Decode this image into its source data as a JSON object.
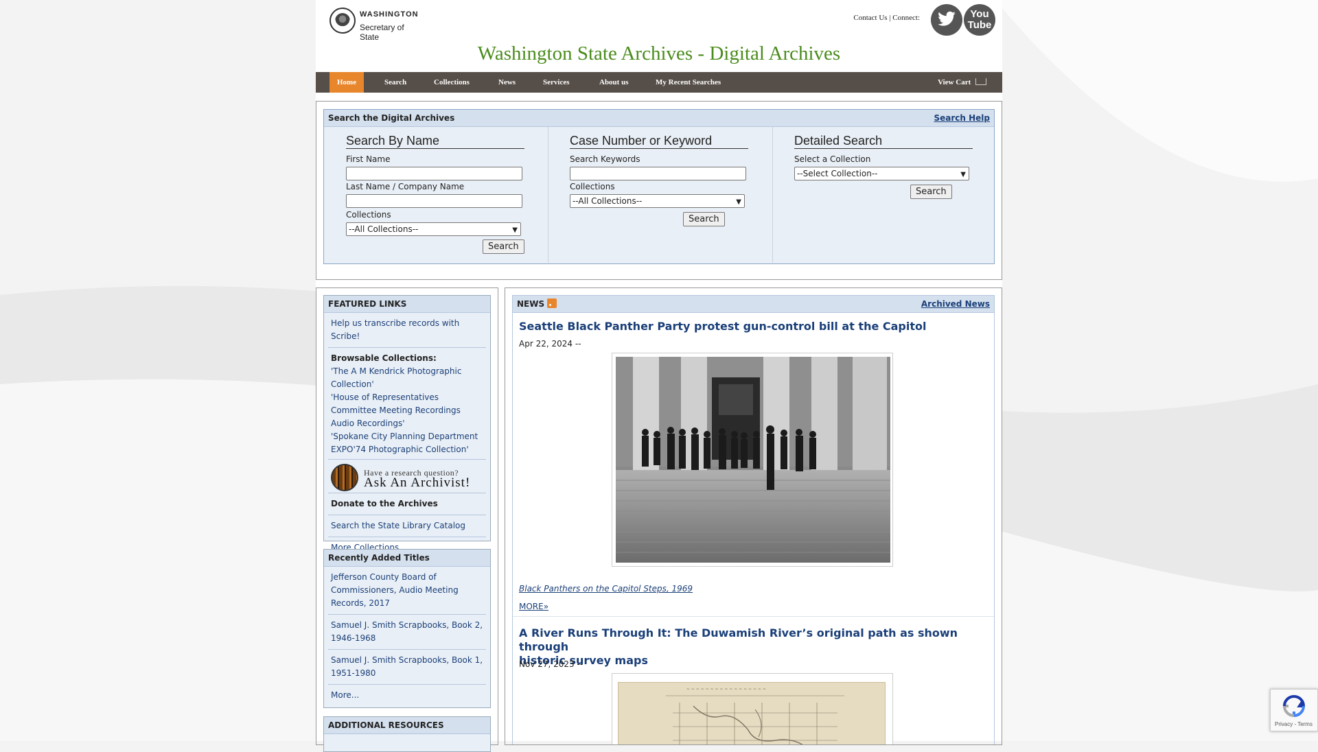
{
  "header": {
    "logo_line1": "WASHINGTON",
    "logo_line2": "Secretary of State",
    "contact_us": "Contact Us",
    "separator": "|",
    "connect": "Connect:",
    "youtube_line1": "You",
    "youtube_line2": "Tube",
    "site_title": "Washington State Archives - Digital Archives"
  },
  "nav": {
    "items": [
      "Home",
      "Search",
      "Collections",
      "News",
      "Services",
      "About us",
      "My Recent Searches"
    ],
    "active": "Home",
    "cart": "View Cart"
  },
  "search_panel": {
    "title": "Search the Digital Archives",
    "help": "Search Help",
    "by_name": {
      "heading": "Search By Name",
      "first_name_label": "First Name",
      "last_name_label": "Last Name / Company Name",
      "collections_label": "Collections",
      "collections_value": "--All Collections--",
      "search_button": "Search"
    },
    "keyword": {
      "heading": "Case Number or Keyword",
      "keywords_label": "Search Keywords",
      "collections_label": "Collections",
      "collections_value": "--All Collections--",
      "search_button": "Search"
    },
    "detailed": {
      "heading": "Detailed Search",
      "select_label": "Select a Collection",
      "select_value": "--Select Collection--",
      "search_button": "Search"
    }
  },
  "featured_links": {
    "title": "FEATURED LINKS",
    "scribe": "Help us transcribe records with Scribe!",
    "browsable_title": "Browsable Collections:",
    "browsable": [
      "'The A M Kendrick Photographic Collection'",
      "'House of Representatives Committee Meeting Recordings Audio Recordings'",
      "'Spokane City Planning Department EXPO'74 Photographic Collection'"
    ],
    "ask_line1": "Have a research question?",
    "ask_line2": "Ask An Archivist!",
    "donate": "Donate to the Archives",
    "library": "Search the State Library Catalog",
    "more": "More Collections..."
  },
  "recent_titles": {
    "title": "Recently Added Titles",
    "items": [
      "Jefferson County Board of Commissioners, Audio Meeting Records, 2017",
      "Samuel J. Smith Scrapbooks, Book 2, 1946-1968",
      "Samuel J. Smith Scrapbooks, Book 1, 1951-1980"
    ],
    "more": "More..."
  },
  "additional": {
    "title": "ADDITIONAL RESOURCES"
  },
  "news": {
    "title": "NEWS",
    "archived": "Archived News",
    "items": [
      {
        "title": "Seattle Black Panther Party protest gun-control bill at the Capitol",
        "date": "Apr 22, 2024 --",
        "caption": "Black Panthers on the Capitol Steps, 1969",
        "more": "MORE»"
      },
      {
        "title_line1": "A River Runs Through It: The Duwamish River’s original path as shown through",
        "title_line2": "historic survey maps",
        "date": "Nov 27, 2023 --"
      }
    ]
  },
  "recaptcha": {
    "text": "Privacy - Terms"
  },
  "colors": {
    "accent": "#e8862c",
    "nav_bg": "#564e48",
    "title_green": "#4a8c1c",
    "link": "#1a3f78",
    "panel_bg": "#e9eff6"
  }
}
